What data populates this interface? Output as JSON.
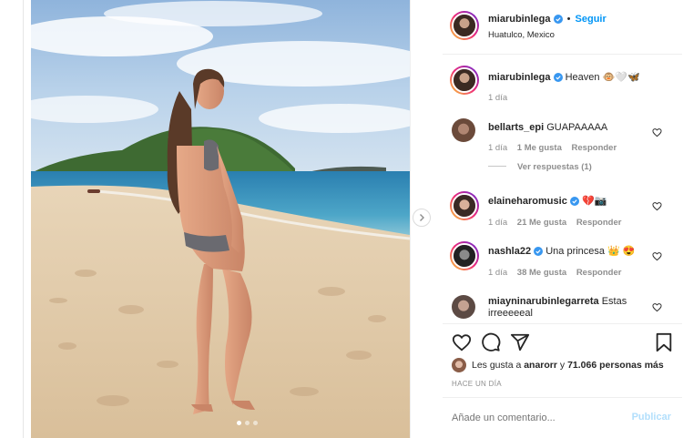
{
  "post": {
    "author": "miarubinlega",
    "follow_separator": "•",
    "follow_label": "Seguir",
    "location": "Huatulco, Mexico"
  },
  "caption": {
    "author": "miarubinlega",
    "text": "Heaven 🐵🤍🦋",
    "time": "1 día"
  },
  "comments": [
    {
      "user": "bellarts_epi",
      "verified": false,
      "text": "GUAPAAAAA",
      "time": "1 día",
      "likes": "1 Me gusta",
      "reply": "Responder",
      "replies_label": "Ver respuestas (1)"
    },
    {
      "user": "elaineharomusic",
      "verified": true,
      "text": "💔📷",
      "time": "1 día",
      "likes": "21 Me gusta",
      "reply": "Responder"
    },
    {
      "user": "nashla22",
      "verified": true,
      "text": "Una princesa 👑 😍",
      "time": "1 día",
      "likes": "38 Me gusta",
      "reply": "Responder"
    },
    {
      "user": "miayninarubinlegarreta",
      "verified": false,
      "text": "Estas irreeeeeal",
      "time": "",
      "likes": "",
      "reply": ""
    }
  ],
  "likes": {
    "prefix": "Les gusta a",
    "user": "anarorr",
    "joiner": "y",
    "count": "71.066 personas más"
  },
  "timestamp": "HACE UN DÍA",
  "composer": {
    "placeholder": "Añade un comentario...",
    "submit_label": "Publicar"
  },
  "colors": {
    "link_blue": "#0095f6",
    "muted": "#8e8e8e",
    "text": "#262626"
  },
  "icons": [
    "heart-icon",
    "comment-icon",
    "share-icon",
    "bookmark-icon",
    "verified-badge-icon",
    "chevron-right-icon"
  ]
}
